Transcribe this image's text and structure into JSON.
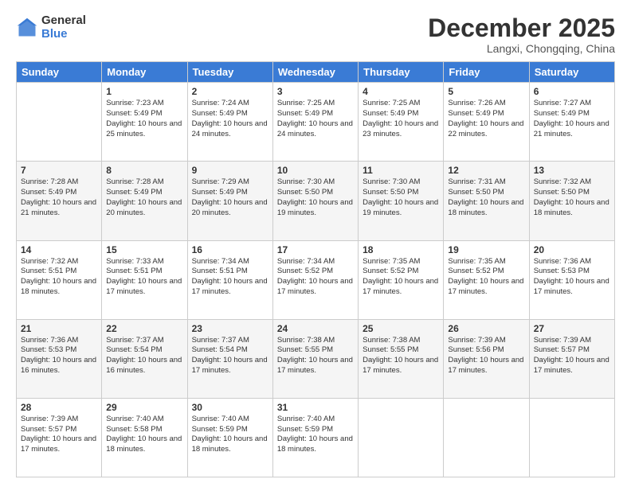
{
  "header": {
    "logo_general": "General",
    "logo_blue": "Blue",
    "month_title": "December 2025",
    "location": "Langxi, Chongqing, China"
  },
  "days_of_week": [
    "Sunday",
    "Monday",
    "Tuesday",
    "Wednesday",
    "Thursday",
    "Friday",
    "Saturday"
  ],
  "weeks": [
    [
      {
        "day": "",
        "info": ""
      },
      {
        "day": "1",
        "info": "Sunrise: 7:23 AM\nSunset: 5:49 PM\nDaylight: 10 hours\nand 25 minutes."
      },
      {
        "day": "2",
        "info": "Sunrise: 7:24 AM\nSunset: 5:49 PM\nDaylight: 10 hours\nand 24 minutes."
      },
      {
        "day": "3",
        "info": "Sunrise: 7:25 AM\nSunset: 5:49 PM\nDaylight: 10 hours\nand 24 minutes."
      },
      {
        "day": "4",
        "info": "Sunrise: 7:25 AM\nSunset: 5:49 PM\nDaylight: 10 hours\nand 23 minutes."
      },
      {
        "day": "5",
        "info": "Sunrise: 7:26 AM\nSunset: 5:49 PM\nDaylight: 10 hours\nand 22 minutes."
      },
      {
        "day": "6",
        "info": "Sunrise: 7:27 AM\nSunset: 5:49 PM\nDaylight: 10 hours\nand 21 minutes."
      }
    ],
    [
      {
        "day": "7",
        "info": "Sunrise: 7:28 AM\nSunset: 5:49 PM\nDaylight: 10 hours\nand 21 minutes."
      },
      {
        "day": "8",
        "info": "Sunrise: 7:28 AM\nSunset: 5:49 PM\nDaylight: 10 hours\nand 20 minutes."
      },
      {
        "day": "9",
        "info": "Sunrise: 7:29 AM\nSunset: 5:49 PM\nDaylight: 10 hours\nand 20 minutes."
      },
      {
        "day": "10",
        "info": "Sunrise: 7:30 AM\nSunset: 5:50 PM\nDaylight: 10 hours\nand 19 minutes."
      },
      {
        "day": "11",
        "info": "Sunrise: 7:30 AM\nSunset: 5:50 PM\nDaylight: 10 hours\nand 19 minutes."
      },
      {
        "day": "12",
        "info": "Sunrise: 7:31 AM\nSunset: 5:50 PM\nDaylight: 10 hours\nand 18 minutes."
      },
      {
        "day": "13",
        "info": "Sunrise: 7:32 AM\nSunset: 5:50 PM\nDaylight: 10 hours\nand 18 minutes."
      }
    ],
    [
      {
        "day": "14",
        "info": "Sunrise: 7:32 AM\nSunset: 5:51 PM\nDaylight: 10 hours\nand 18 minutes."
      },
      {
        "day": "15",
        "info": "Sunrise: 7:33 AM\nSunset: 5:51 PM\nDaylight: 10 hours\nand 17 minutes."
      },
      {
        "day": "16",
        "info": "Sunrise: 7:34 AM\nSunset: 5:51 PM\nDaylight: 10 hours\nand 17 minutes."
      },
      {
        "day": "17",
        "info": "Sunrise: 7:34 AM\nSunset: 5:52 PM\nDaylight: 10 hours\nand 17 minutes."
      },
      {
        "day": "18",
        "info": "Sunrise: 7:35 AM\nSunset: 5:52 PM\nDaylight: 10 hours\nand 17 minutes."
      },
      {
        "day": "19",
        "info": "Sunrise: 7:35 AM\nSunset: 5:52 PM\nDaylight: 10 hours\nand 17 minutes."
      },
      {
        "day": "20",
        "info": "Sunrise: 7:36 AM\nSunset: 5:53 PM\nDaylight: 10 hours\nand 17 minutes."
      }
    ],
    [
      {
        "day": "21",
        "info": "Sunrise: 7:36 AM\nSunset: 5:53 PM\nDaylight: 10 hours\nand 16 minutes."
      },
      {
        "day": "22",
        "info": "Sunrise: 7:37 AM\nSunset: 5:54 PM\nDaylight: 10 hours\nand 16 minutes."
      },
      {
        "day": "23",
        "info": "Sunrise: 7:37 AM\nSunset: 5:54 PM\nDaylight: 10 hours\nand 17 minutes."
      },
      {
        "day": "24",
        "info": "Sunrise: 7:38 AM\nSunset: 5:55 PM\nDaylight: 10 hours\nand 17 minutes."
      },
      {
        "day": "25",
        "info": "Sunrise: 7:38 AM\nSunset: 5:55 PM\nDaylight: 10 hours\nand 17 minutes."
      },
      {
        "day": "26",
        "info": "Sunrise: 7:39 AM\nSunset: 5:56 PM\nDaylight: 10 hours\nand 17 minutes."
      },
      {
        "day": "27",
        "info": "Sunrise: 7:39 AM\nSunset: 5:57 PM\nDaylight: 10 hours\nand 17 minutes."
      }
    ],
    [
      {
        "day": "28",
        "info": "Sunrise: 7:39 AM\nSunset: 5:57 PM\nDaylight: 10 hours\nand 17 minutes."
      },
      {
        "day": "29",
        "info": "Sunrise: 7:40 AM\nSunset: 5:58 PM\nDaylight: 10 hours\nand 18 minutes."
      },
      {
        "day": "30",
        "info": "Sunrise: 7:40 AM\nSunset: 5:59 PM\nDaylight: 10 hours\nand 18 minutes."
      },
      {
        "day": "31",
        "info": "Sunrise: 7:40 AM\nSunset: 5:59 PM\nDaylight: 10 hours\nand 18 minutes."
      },
      {
        "day": "",
        "info": ""
      },
      {
        "day": "",
        "info": ""
      },
      {
        "day": "",
        "info": ""
      }
    ]
  ]
}
